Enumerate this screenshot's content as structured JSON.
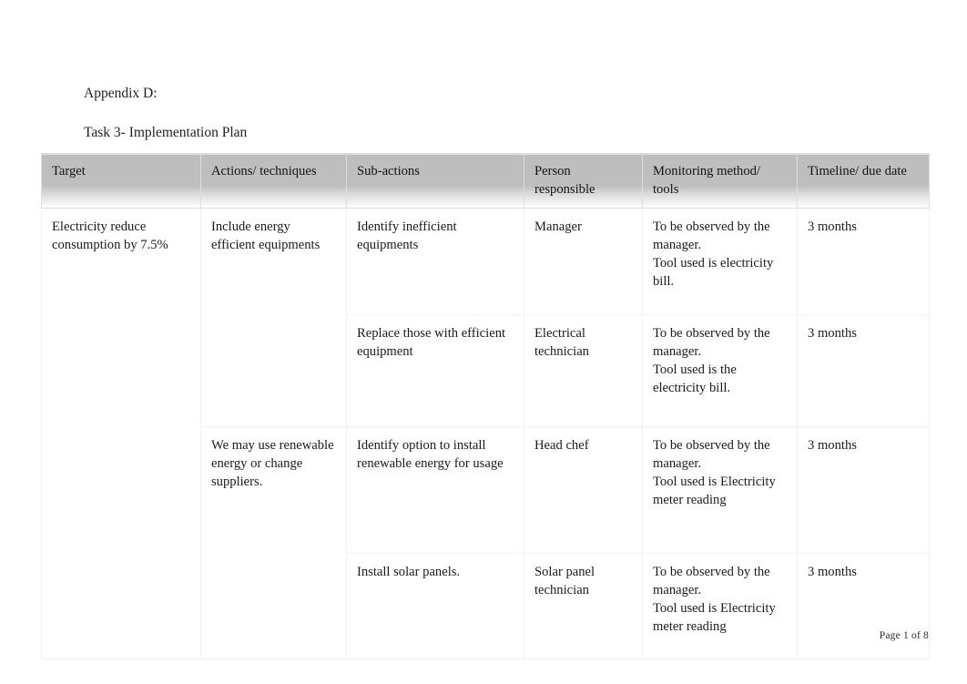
{
  "document": {
    "appendix_label": "Appendix D:",
    "task_title": "Task 3- Implementation Plan"
  },
  "table": {
    "headers": [
      "Target",
      "Actions/ techniques",
      "Sub-actions",
      "Person responsible",
      "Monitoring method/ tools",
      "Timeline/ due date"
    ],
    "target": "Electricity reduce consumption by 7.5%",
    "rows": [
      {
        "action": "Include energy efficient equipments",
        "sub_action": "Identify inefficient equipments",
        "person": "Manager",
        "monitoring": "To be observed by the manager.\nTool used is electricity bill.",
        "timeline": "3 months"
      },
      {
        "action": "",
        "sub_action": "Replace those with efficient equipment",
        "person": "Electrical technician",
        "monitoring": "To be observed by the manager.\nTool used is the electricity bill.",
        "timeline": "3 months"
      },
      {
        "action": " We may use renewable energy or change suppliers.",
        "sub_action": " Identify option to install renewable energy for usage",
        "person": "Head chef",
        "monitoring": "To be observed by the manager.\nTool used is Electricity meter reading",
        "timeline": "3 months"
      },
      {
        "action": "",
        "sub_action": " Install solar panels.",
        "person": "Solar panel technician",
        "monitoring": "To be observed by the manager.\nTool used is Electricity meter reading",
        "timeline": "3 months"
      }
    ]
  },
  "footer": {
    "page_label": "Page 1  of 8"
  },
  "colors": {
    "header_band": "#bebebe",
    "text": "#1a1a1a",
    "page_background": "#ffffff",
    "cell_border": "#f1f1f1"
  }
}
